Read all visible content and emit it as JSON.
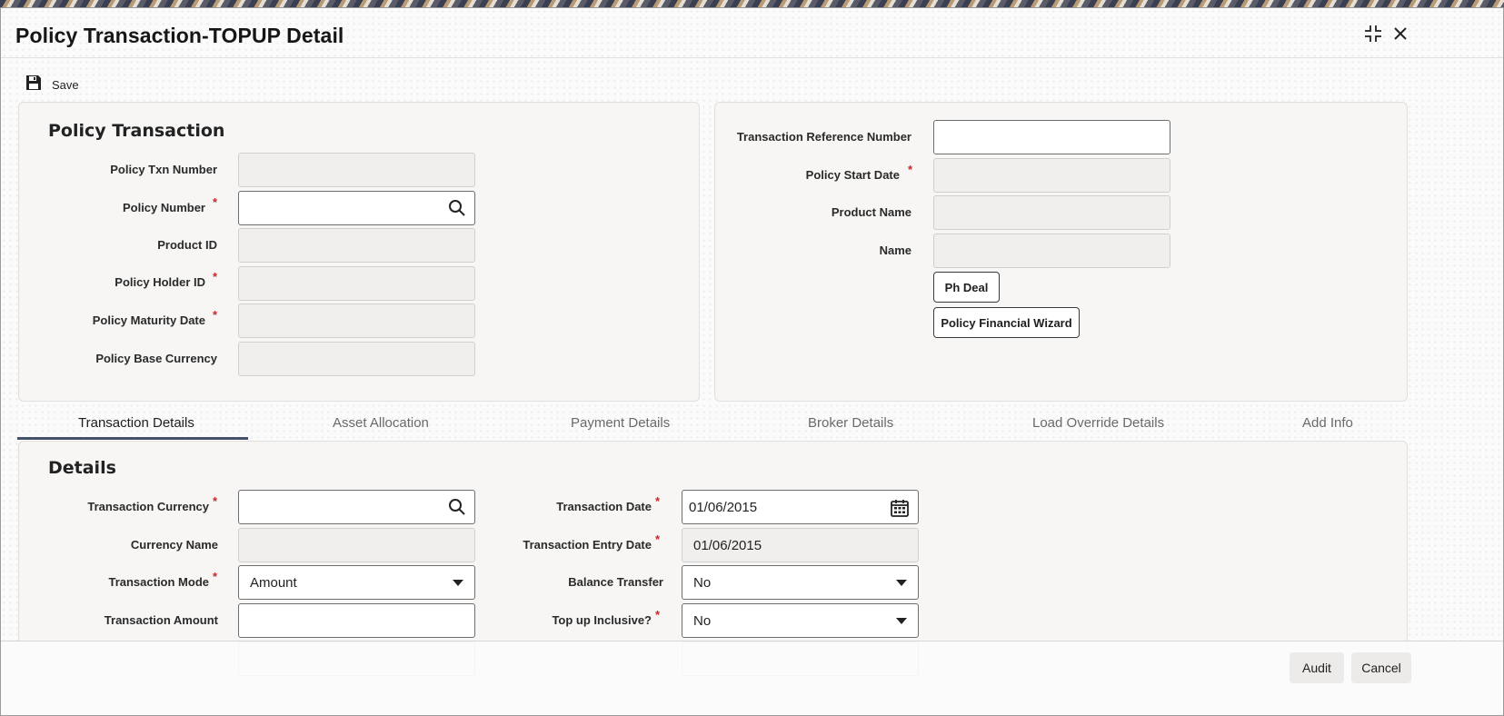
{
  "window": {
    "title": "Policy Transaction-TOPUP Detail"
  },
  "toolbar": {
    "save_label": "Save"
  },
  "policy_transaction": {
    "section_title": "Policy Transaction",
    "policy_txn_number": {
      "label": "Policy Txn Number",
      "value": ""
    },
    "policy_number": {
      "label": "Policy Number",
      "required": "*",
      "value": ""
    },
    "product_id": {
      "label": "Product ID",
      "value": ""
    },
    "policy_holder_id": {
      "label": "Policy Holder ID",
      "required": "*",
      "value": ""
    },
    "policy_maturity_date": {
      "label": "Policy Maturity Date",
      "required": "*",
      "value": ""
    },
    "policy_base_currency": {
      "label": "Policy Base Currency",
      "value": ""
    }
  },
  "right_panel": {
    "transaction_reference_number": {
      "label": "Transaction Reference Number",
      "value": ""
    },
    "policy_start_date": {
      "label": "Policy Start Date",
      "required": "*",
      "value": ""
    },
    "product_name": {
      "label": "Product Name",
      "value": ""
    },
    "name": {
      "label": "Name",
      "value": ""
    },
    "ph_deal_button": "Ph Deal",
    "policy_financial_wizard_button": "Policy Financial Wizard"
  },
  "tabs": [
    {
      "label": "Transaction Details",
      "active": true
    },
    {
      "label": "Asset Allocation",
      "active": false
    },
    {
      "label": "Payment Details",
      "active": false
    },
    {
      "label": "Broker Details",
      "active": false
    },
    {
      "label": "Load Override Details",
      "active": false
    },
    {
      "label": "Add Info",
      "active": false
    }
  ],
  "details": {
    "section_title": "Details",
    "transaction_currency": {
      "label": "Transaction Currency",
      "required": "*",
      "value": ""
    },
    "currency_name": {
      "label": "Currency Name",
      "value": ""
    },
    "transaction_mode": {
      "label": "Transaction Mode",
      "required": "*",
      "value": "Amount"
    },
    "transaction_amount": {
      "label": "Transaction Amount",
      "value": ""
    },
    "transaction_date": {
      "label": "Transaction Date",
      "required": "*",
      "value": "01/06/2015"
    },
    "transaction_entry_date": {
      "label": "Transaction Entry Date",
      "required": "*",
      "value": "01/06/2015"
    },
    "balance_transfer": {
      "label": "Balance Transfer",
      "value": "No"
    },
    "top_up_inclusive": {
      "label": "Top up Inclusive?",
      "required": "*",
      "value": "No"
    }
  },
  "footer": {
    "audit_label": "Audit",
    "cancel_label": "Cancel"
  },
  "icons": {
    "save": "floppy-disk-icon",
    "maximize": "maximize-icon",
    "close": "close-icon",
    "search": "search-icon",
    "calendar": "calendar-icon",
    "dropdown": "chevron-down-icon"
  },
  "colors": {
    "tab_underline": "#45506a",
    "required_marker": "#c8262b"
  }
}
